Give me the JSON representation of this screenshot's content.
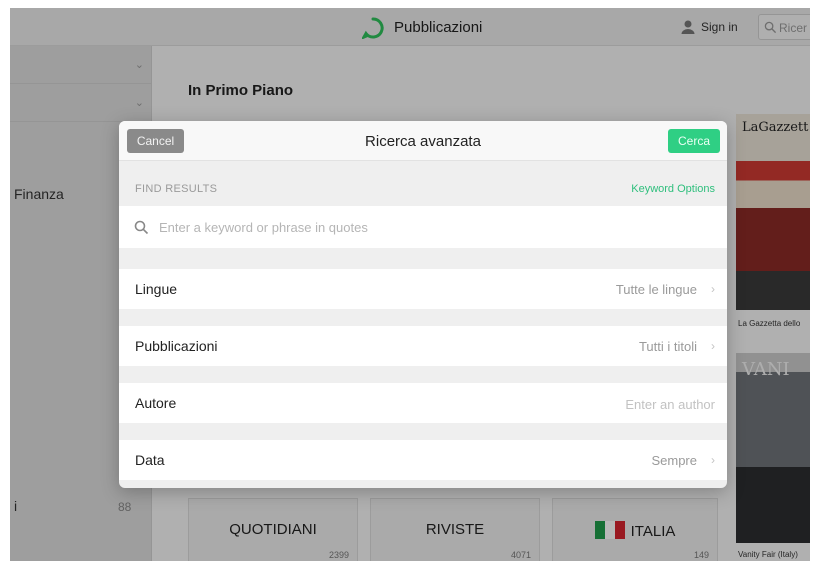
{
  "header": {
    "app_title": "Pubblicazioni",
    "sign_in": "Sign in",
    "search_placeholder": "Ricer"
  },
  "sidebar": {
    "items": [
      {
        "label": "Finanza",
        "count": ""
      },
      {
        "label": "i",
        "count": "88"
      }
    ]
  },
  "main": {
    "section_title": "In Primo Piano",
    "tiles": [
      {
        "label": "QUOTIDIANI",
        "count": "2399"
      },
      {
        "label": "RIVISTE",
        "count": "4071"
      },
      {
        "label": "ITALIA",
        "count": "149"
      }
    ],
    "magazines": [
      {
        "cover_text": "LaGazzett",
        "caption": "La Gazzetta dello"
      },
      {
        "cover_text": "VANI",
        "caption": "Vanity Fair (Italy)"
      }
    ]
  },
  "modal": {
    "title": "Ricerca avanzata",
    "cancel_label": "Cancel",
    "search_label": "Cerca",
    "find_results_label": "FIND RESULTS",
    "keyword_options_label": "Keyword Options",
    "keyword_placeholder": "Enter a keyword or phrase in quotes",
    "keyword_value": "",
    "options": [
      {
        "label": "Lingue",
        "value": "Tutte le lingue"
      },
      {
        "label": "Pubblicazioni",
        "value": "Tutti i titoli"
      },
      {
        "label": "Autore",
        "value": "",
        "placeholder": "Enter an author"
      },
      {
        "label": "Data",
        "value": "Sempre"
      }
    ]
  },
  "colors": {
    "accent_green": "#2fcf84",
    "keyword_options_green": "#2fbf7d",
    "cancel_gray": "#8a8a8a"
  },
  "icons": {
    "logo": "speech-bubble-logo-icon",
    "user": "user-icon",
    "search": "search-icon",
    "chevron": "chevron-right-icon"
  }
}
